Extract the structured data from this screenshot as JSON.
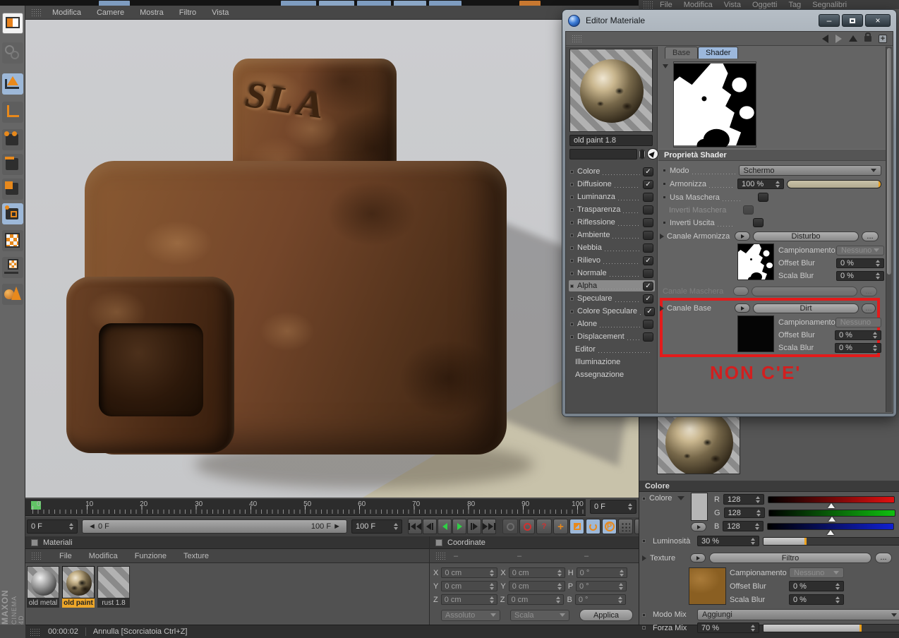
{
  "menubar": {
    "items": [
      "Modifica",
      "Camere",
      "Mostra",
      "Filtro",
      "Vista"
    ]
  },
  "object_manager_menubar": {
    "items": [
      "File",
      "Modifica",
      "Vista",
      "Oggetti",
      "Tag",
      "Segnalibri"
    ]
  },
  "viewport": {
    "object_text": "SLA"
  },
  "timeline": {
    "ticks": [
      "0",
      "10",
      "20",
      "30",
      "40",
      "50",
      "60",
      "70",
      "80",
      "90",
      "100"
    ],
    "current": "0 F",
    "range_start": "◄ 0 F",
    "range_end": "100 F ►",
    "end": "100 F",
    "right_field": "0 F"
  },
  "materials_panel": {
    "title": "Materiali",
    "menu": [
      "File",
      "Modifica",
      "Funzione",
      "Texture"
    ],
    "items": [
      {
        "name": "old metal"
      },
      {
        "name": "old paint"
      },
      {
        "name": "rust 1.8"
      }
    ]
  },
  "coordinates_panel": {
    "title": "Coordinate",
    "dash": "–",
    "rows": [
      {
        "l1": "X",
        "v1": "0 cm",
        "l2": "X",
        "v2": "0 cm",
        "l3": "H",
        "v3": "0 °"
      },
      {
        "l1": "Y",
        "v1": "0 cm",
        "l2": "Y",
        "v2": "0 cm",
        "l3": "P",
        "v3": "0 °"
      },
      {
        "l1": "Z",
        "v1": "0 cm",
        "l2": "Z",
        "v2": "0 cm",
        "l3": "B",
        "v3": "0 °"
      }
    ],
    "mode": "Assoluto",
    "scale_mode": "Scala",
    "apply": "Applica"
  },
  "status_bar": {
    "time": "00:00:02",
    "message": "Annulla [Scorciatoia Ctrl+Z]"
  },
  "brand": {
    "maxon": "MAXON",
    "cinema": "CINEMA 4D"
  },
  "dialog": {
    "title": "Editor Materiale",
    "tabs": {
      "base": "Base",
      "shader": "Shader"
    },
    "material_name": "old paint 1.8",
    "channels": [
      {
        "label": "Colore",
        "checked": true
      },
      {
        "label": "Diffusione",
        "checked": true
      },
      {
        "label": "Luminanza",
        "checked": false
      },
      {
        "label": "Trasparenza",
        "checked": false
      },
      {
        "label": "Riflessione",
        "checked": false
      },
      {
        "label": "Ambiente",
        "checked": false
      },
      {
        "label": "Nebbia",
        "checked": false
      },
      {
        "label": "Rilievo",
        "checked": true
      },
      {
        "label": "Normale",
        "checked": false
      },
      {
        "label": "Alpha",
        "checked": true
      },
      {
        "label": "Speculare",
        "checked": true
      },
      {
        "label": "Colore Speculare",
        "checked": true
      },
      {
        "label": "Alone",
        "checked": false
      },
      {
        "label": "Displacement",
        "checked": false
      },
      {
        "label": "Editor"
      },
      {
        "label": "Illuminazione"
      },
      {
        "label": "Assegnazione"
      }
    ],
    "props": {
      "header": "Proprietà Shader",
      "modo": {
        "label": "Modo",
        "value": "Schermo"
      },
      "armonizza": {
        "label": "Armonizza",
        "value": "100 %"
      },
      "usa_maschera": "Usa Maschera",
      "inverti_maschera": "Inverti Maschera",
      "inverti_uscita": "Inverti Uscita",
      "canale_armonizza": {
        "label": "Canale Armonizza",
        "value": "Disturbo",
        "more": "..."
      },
      "armonizza_sub": {
        "campionamento": "Campionamento",
        "campionamento_value": "Nessuno",
        "offset_blur": "Offset Blur",
        "offset_blur_value": "0 %",
        "scala_blur": "Scala Blur",
        "scala_blur_value": "0 %"
      },
      "canale_maschera": {
        "label": "Canale Maschera",
        "more": "..."
      },
      "canale_base": {
        "label": "Canale Base",
        "value": "Dirt",
        "more": "..."
      },
      "base_sub": {
        "campionamento": "Campionamento",
        "campionamento_value": "Nessuno",
        "offset_blur": "Offset Blur",
        "offset_blur_value": "0 %",
        "scala_blur": "Scala Blur",
        "scala_blur_value": "0 %"
      }
    },
    "annotation": "NON C'E'"
  },
  "color_panel": {
    "title": "Colore",
    "colore_label": "Colore",
    "channels": [
      {
        "label": "R",
        "value": "128"
      },
      {
        "label": "G",
        "value": "128"
      },
      {
        "label": "B",
        "value": "128"
      }
    ],
    "luminosita": {
      "label": "Luminosità",
      "value": "30 %"
    },
    "texture": {
      "label": "Texture",
      "value": "Filtro",
      "more": "..."
    },
    "sub": {
      "campionamento": "Campionamento",
      "campionamento_value": "Nessuno",
      "offset_blur": "Offset Blur",
      "offset_blur_value": "0 %",
      "scala_blur": "Scala Blur",
      "scala_blur_value": "0 %"
    },
    "modo_mix": {
      "label": "Modo Mix",
      "value": "Aggiungi"
    },
    "forza_mix": {
      "label": "Forza Mix",
      "value": "70 %"
    }
  },
  "colors": {
    "accent_orange": "#e8951c",
    "selected_tab_blue": "#9cb8dc",
    "play_green": "#2fd045",
    "alert_red": "#e31b1b"
  }
}
